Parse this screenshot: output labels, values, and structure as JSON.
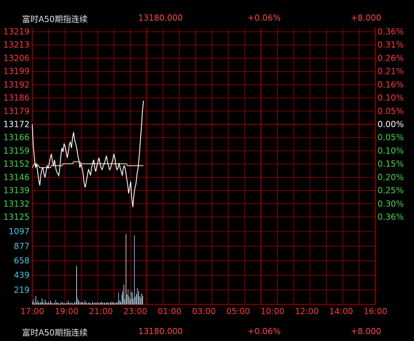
{
  "header": {
    "name": "富时A50期指连续",
    "price": "13180.000",
    "change_pct": "+0.06%",
    "change": "+8.000"
  },
  "footer": {
    "name": "富时A50期指连续",
    "price": "13180.000",
    "change_pct": "+0.06%",
    "change": "+8.000"
  },
  "colors": {
    "background": "#000000",
    "grid": "#8b0000",
    "up": "#ff3c3c",
    "down": "#4cd94c",
    "flat": "#ffffff",
    "volume_axis": "#4fc3e8",
    "price_line": "#ffffff",
    "avg_line": "#ffffc8"
  },
  "chart_data": [
    {
      "type": "line",
      "title": "",
      "ylim": [
        13125,
        13219
      ],
      "prev_close": 13172,
      "price_ticks": [
        {
          "label": "13219",
          "trend": "up"
        },
        {
          "label": "13213",
          "trend": "up"
        },
        {
          "label": "13206",
          "trend": "up"
        },
        {
          "label": "13199",
          "trend": "up"
        },
        {
          "label": "13192",
          "trend": "up"
        },
        {
          "label": "13186",
          "trend": "up"
        },
        {
          "label": "13179",
          "trend": "up"
        },
        {
          "label": "13172",
          "trend": "flat"
        },
        {
          "label": "13166",
          "trend": "down"
        },
        {
          "label": "13159",
          "trend": "down"
        },
        {
          "label": "13152",
          "trend": "down"
        },
        {
          "label": "13146",
          "trend": "down"
        },
        {
          "label": "13139",
          "trend": "down"
        },
        {
          "label": "13132",
          "trend": "down"
        },
        {
          "label": "13125",
          "trend": "down"
        }
      ],
      "pct_ticks": [
        "0.36%",
        "0.31%",
        "0.26%",
        "0.21%",
        "0.16%",
        "0.10%",
        "0.05%",
        "0.00%",
        "0.05%",
        "0.10%",
        "0.15%",
        "0.20%",
        "0.25%",
        "0.30%",
        "0.36%"
      ],
      "time_labels": [
        "17:00",
        "19:00",
        "21:00",
        "23:00",
        "01:00",
        "03:00",
        "05:00",
        "10:00",
        "12:00",
        "14:00",
        "16:00"
      ],
      "series": [
        {
          "values": [
            13172,
            13160,
            13155,
            13150,
            13152,
            13148,
            13144,
            13141,
            13146,
            13149,
            13150,
            13147,
            13145,
            13148,
            13151,
            13150,
            13152,
            13155,
            13157,
            13153,
            13151,
            13154,
            13150,
            13148,
            13147,
            13146,
            13150,
            13156,
            13160,
            13158,
            13162,
            13161,
            13158,
            13155,
            13158,
            13162,
            13163,
            13160,
            13165,
            13168,
            13164,
            13162,
            13160,
            13156,
            13154,
            13150,
            13152,
            13150,
            13147,
            13142,
            13140,
            13143,
            13146,
            13149,
            13148,
            13146,
            13150,
            13152,
            13154,
            13150,
            13148,
            13151,
            13153,
            13155,
            13152,
            13150,
            13149,
            13151,
            13152,
            13154,
            13156,
            13153,
            13151,
            13149,
            13150,
            13152,
            13154,
            13157,
            13155,
            13151,
            13149,
            13150,
            13152,
            13150,
            13148,
            13146,
            13150,
            13151,
            13149,
            13145,
            13142,
            13137,
            13140,
            13143,
            13134,
            13130,
            13136,
            13140,
            13142,
            13147,
            13150,
            13156,
            13163,
            13170,
            13178,
            13184
          ]
        },
        {
          "values": [
            13150,
            13151,
            13152,
            13152,
            13152,
            13151,
            13151,
            13150,
            13150,
            13150,
            13150,
            13150,
            13150,
            13150,
            13150,
            13150,
            13150,
            13150,
            13151,
            13151,
            13151,
            13151,
            13151,
            13151,
            13151,
            13151,
            13151,
            13151,
            13151,
            13152,
            13152,
            13152,
            13152,
            13152,
            13152,
            13152,
            13152,
            13152,
            13152,
            13153,
            13153,
            13153,
            13153,
            13153,
            13153,
            13153,
            13152,
            13152,
            13152,
            13152,
            13152,
            13152,
            13152,
            13152,
            13152,
            13152,
            13152,
            13152,
            13152,
            13152,
            13152,
            13152,
            13152,
            13152,
            13152,
            13152,
            13152,
            13152,
            13152,
            13152,
            13152,
            13152,
            13152,
            13152,
            13152,
            13152,
            13152,
            13152,
            13152,
            13152,
            13152,
            13152,
            13152,
            13152,
            13152,
            13152,
            13152,
            13152,
            13152,
            13152,
            13151,
            13151,
            13151,
            13151,
            13151,
            13151,
            13151,
            13151,
            13151,
            13151,
            13151,
            13151,
            13151,
            13151,
            13151,
            13151
          ]
        }
      ]
    },
    {
      "type": "bar",
      "title": "",
      "ylim": [
        0,
        1317
      ],
      "volume_ticks": [
        "1097",
        "877",
        "658",
        "439",
        "219"
      ],
      "values": [
        40,
        80,
        20,
        130,
        30,
        60,
        25,
        35,
        30,
        90,
        40,
        20,
        70,
        30,
        25,
        35,
        20,
        60,
        30,
        20,
        20,
        25,
        70,
        25,
        30,
        20,
        15,
        30,
        40,
        20,
        25,
        15,
        20,
        30,
        60,
        25,
        20,
        30,
        20,
        15,
        40,
        30,
        580,
        100,
        60,
        30,
        25,
        40,
        35,
        20,
        60,
        30,
        20,
        25,
        30,
        20,
        15,
        40,
        20,
        25,
        30,
        20,
        35,
        20,
        25,
        30,
        40,
        20,
        30,
        25,
        20,
        35,
        30,
        20,
        25,
        40,
        30,
        35,
        20,
        25,
        30,
        35,
        180,
        60,
        40,
        150,
        200,
        300,
        80,
        1060,
        150,
        230,
        120,
        80,
        200,
        180,
        90,
        1040,
        120,
        160,
        250,
        200,
        130,
        100,
        170,
        130
      ]
    }
  ]
}
